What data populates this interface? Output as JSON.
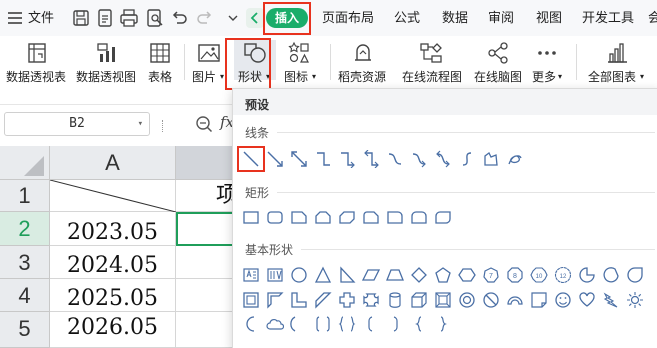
{
  "menubar": {
    "hamburger_label": "文件",
    "tabs": [
      "插入",
      "页面布局",
      "公式",
      "数据",
      "审阅",
      "视图",
      "开发工具",
      "会"
    ],
    "active_tab": "插入"
  },
  "ribbon": {
    "items": [
      "数据透视表",
      "数据透视图",
      "表格",
      "图片",
      "形状",
      "图标",
      "稻壳资源",
      "在线流程图",
      "在线脑图",
      "更多",
      "全部图表"
    ]
  },
  "formula_bar": {
    "name_box": "B2",
    "fx_label": "fx"
  },
  "sheet": {
    "columns": [
      "A"
    ],
    "rows": [
      "1",
      "2",
      "3",
      "4",
      "5"
    ],
    "a_values": [
      "2023.05",
      "2024.05",
      "2025.05",
      "2026.05"
    ],
    "b1_partial": "项"
  },
  "shapes_panel": {
    "preset_label": "预设",
    "sections": [
      "线条",
      "矩形",
      "基本形状"
    ]
  },
  "colors": {
    "accent_green": "#1aad6a",
    "highlight_red": "#e8321e",
    "icon_blue": "#4a6fa5",
    "selection_green": "#1f9e5a"
  }
}
